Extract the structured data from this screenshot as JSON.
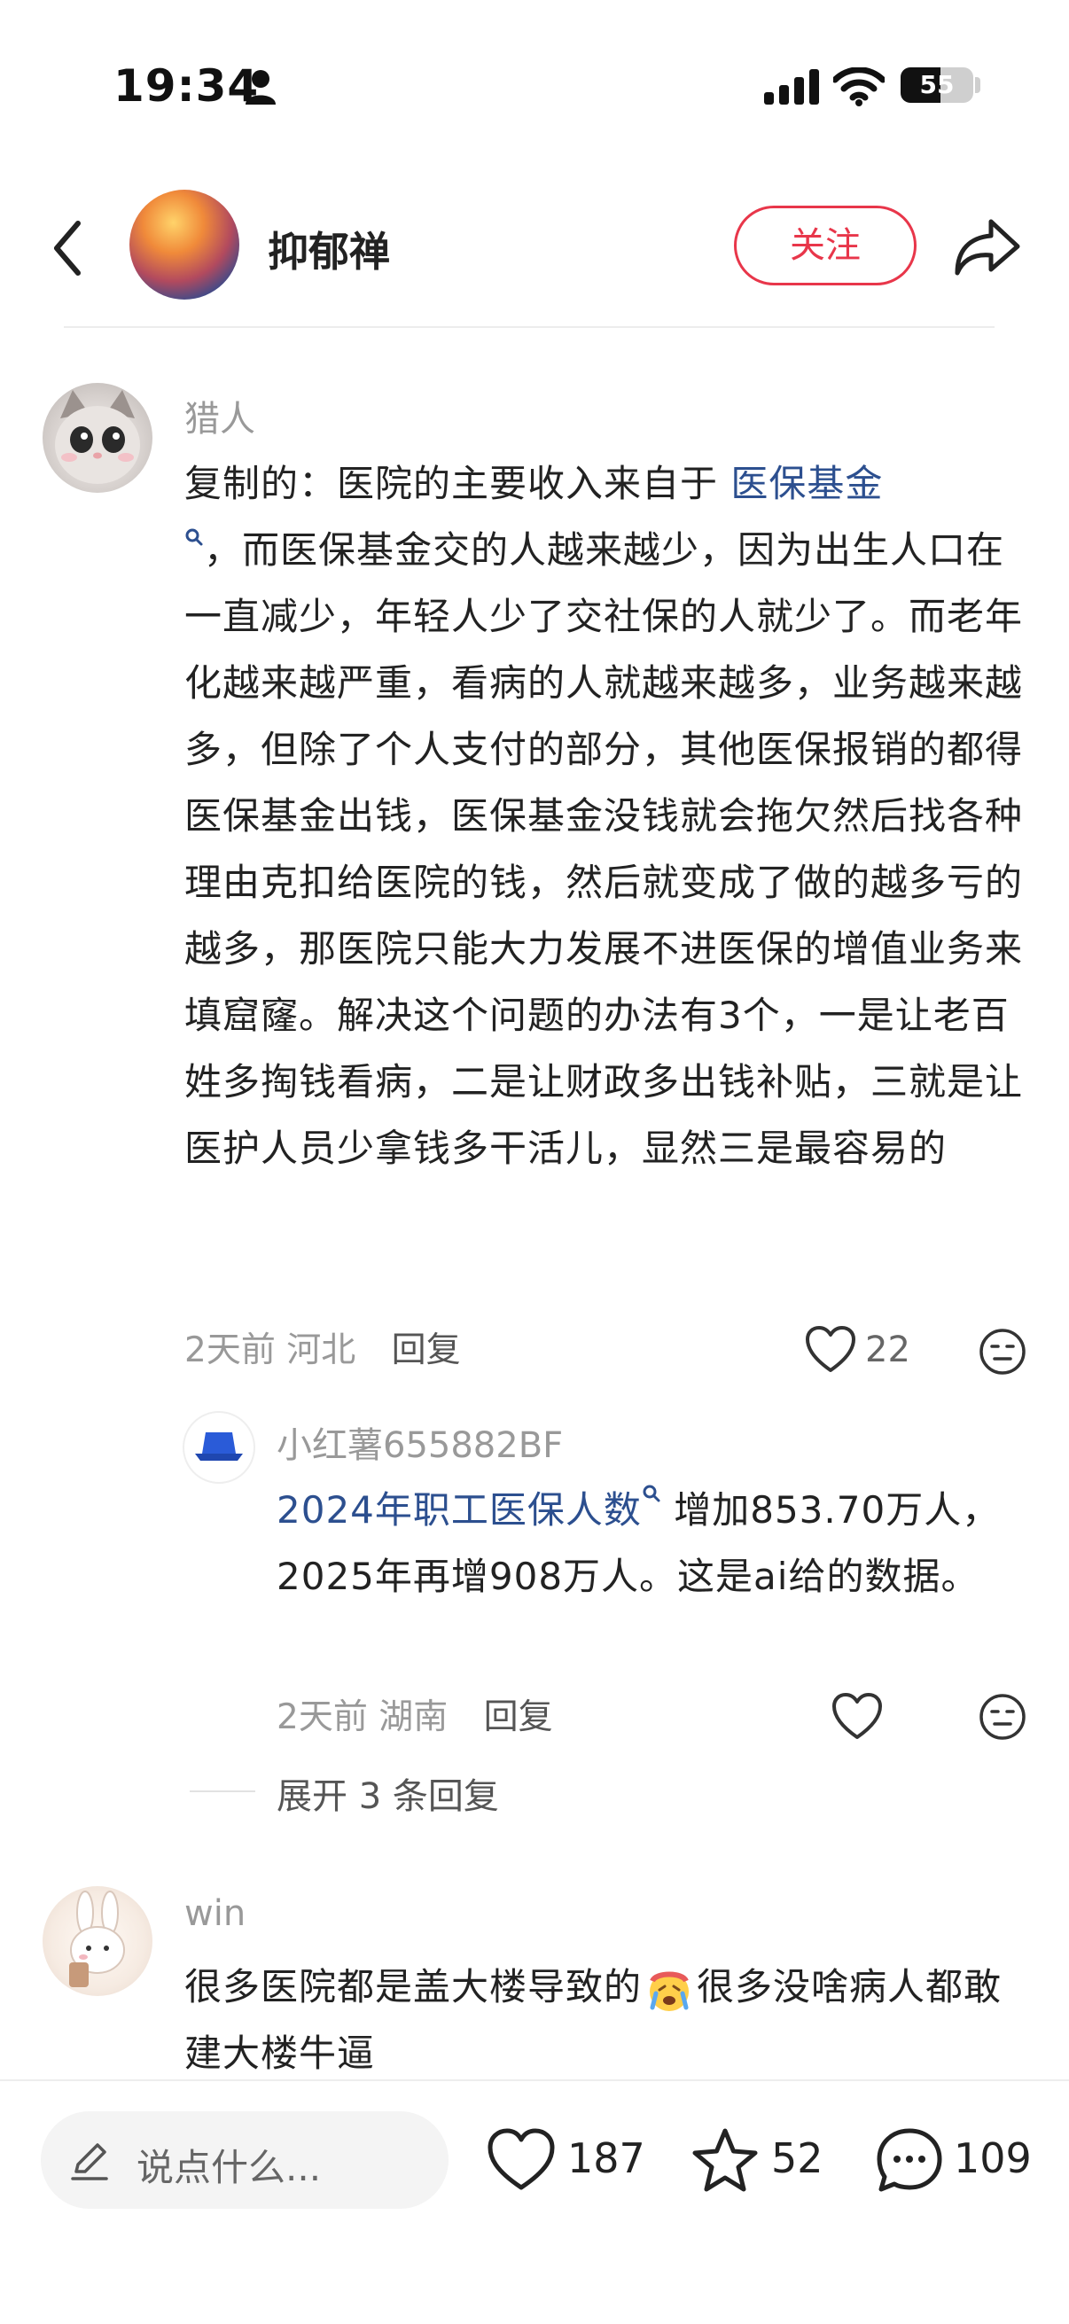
{
  "status": {
    "time": "19:34",
    "battery": "55",
    "battery_level": 0.55
  },
  "header": {
    "author_name": "抑郁禅",
    "follow_label": "关注"
  },
  "comments": [
    {
      "user": "猎人",
      "text_prefix": "复制的：医院的主要收入来自于 ",
      "link": "医保基金",
      "text_suffix": "，而医保基金交的人越来越少，因为出生人口在一直减少，年轻人少了交社保的人就少了。而老年化越来越严重，看病的人就越来越多，业务越来越多，但除了个人支付的部分，其他医保报销的都得医保基金出钱，医保基金没钱就会拖欠然后找各种理由克扣给医院的钱，然后就变成了做的越多亏的越多，那医院只能大力发展不进医保的增值业务来填窟窿。解决这个问题的办法有3个，一是让老百姓多掏钱看病，二是让财政多出钱补贴，三就是让医护人员少拿钱多干活儿，显然三是最容易的",
      "time": "2天前",
      "location": "河北",
      "reply_label": "回复",
      "likes": "22",
      "replies": [
        {
          "user": "小红薯655882BF",
          "link": "2024年职工医保人数",
          "text_suffix": " 增加853.70万人，2025年再增908万人。这是ai给的数据。",
          "time": "2天前",
          "location": "湖南",
          "reply_label": "回复"
        }
      ],
      "expand_label": "展开 3 条回复"
    },
    {
      "user": "win",
      "text_prefix": "很多医院都是盖大楼导致的",
      "text_suffix": "很多没啥病人都敢建大楼牛逼"
    }
  ],
  "bottom_bar": {
    "input_placeholder": "说点什么...",
    "likes": "187",
    "stars": "52",
    "comments": "109"
  },
  "colors": {
    "accent": "#e8364a",
    "link": "#2c4f8f"
  }
}
